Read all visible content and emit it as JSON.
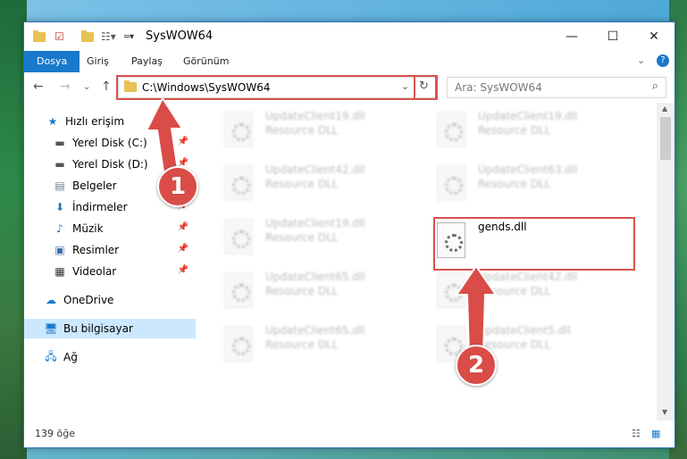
{
  "window": {
    "title": "SysWOW64"
  },
  "ribbon": {
    "tabs": [
      "Dosya",
      "Giriş",
      "Paylaş",
      "Görünüm"
    ]
  },
  "address": {
    "path": "C:\\Windows\\SysWOW64"
  },
  "search": {
    "placeholder": "Ara: SysWOW64"
  },
  "sidebar": {
    "quick_access": "Hızlı erişim",
    "items": [
      {
        "label": "Yerel Disk (C:)",
        "icon": "drive-icon"
      },
      {
        "label": "Yerel Disk (D:)",
        "icon": "drive-icon"
      },
      {
        "label": "Belgeler",
        "icon": "document-icon"
      },
      {
        "label": "İndirmeler",
        "icon": "download-icon"
      },
      {
        "label": "Müzik",
        "icon": "music-icon"
      },
      {
        "label": "Resimler",
        "icon": "pictures-icon"
      },
      {
        "label": "Videolar",
        "icon": "video-icon"
      }
    ],
    "onedrive": "OneDrive",
    "this_pc": "Bu bilgisayar",
    "network": "Ağ"
  },
  "files": [
    {
      "name": "UpdateClient19.dll",
      "desc": "Resource DLL"
    },
    {
      "name": "UpdateClient19.dll",
      "desc": "Resource DLL"
    },
    {
      "name": "UpdateClient42.dll",
      "desc": "Resource DLL"
    },
    {
      "name": "UpdateClient63.dll",
      "desc": "Resource DLL"
    },
    {
      "name": "UpdateClient19.dll",
      "desc": "Resource DLL"
    },
    {
      "name": "gends.dll",
      "desc": ""
    },
    {
      "name": "UpdateClient65.dll",
      "desc": "Resource DLL"
    },
    {
      "name": "UpdateClient42.dll",
      "desc": "Resource DLL"
    },
    {
      "name": "UpdateClient65.dll",
      "desc": "Resource DLL"
    },
    {
      "name": "UpdateClient5.dll",
      "desc": "Resource DLL"
    }
  ],
  "status": {
    "count": "139 öğe"
  },
  "callouts": {
    "one": "1",
    "two": "2"
  },
  "colors": {
    "accent": "#1979ca",
    "highlight": "#d9534f",
    "selected": "#cce8ff"
  }
}
